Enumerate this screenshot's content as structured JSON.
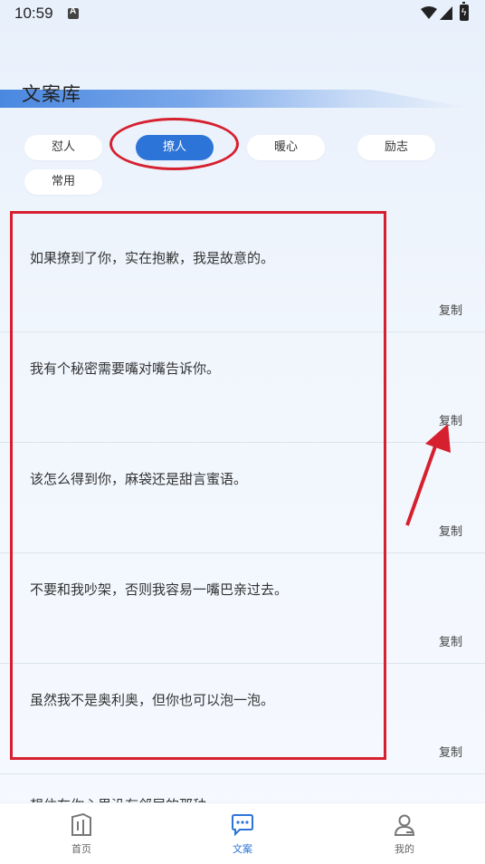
{
  "status_bar": {
    "time": "10:59"
  },
  "page_title": "文案库",
  "tags": [
    {
      "label": "怼人",
      "active": false
    },
    {
      "label": "撩人",
      "active": true
    },
    {
      "label": "暖心",
      "active": false
    },
    {
      "label": "励志",
      "active": false
    },
    {
      "label": "常用",
      "active": false
    }
  ],
  "items": [
    {
      "text": "如果撩到了你，实在抱歉，我是故意的。",
      "copy_label": "复制"
    },
    {
      "text": "我有个秘密需要嘴对嘴告诉你。",
      "copy_label": "复制"
    },
    {
      "text": "该怎么得到你，麻袋还是甜言蜜语。",
      "copy_label": "复制"
    },
    {
      "text": "不要和我吵架，否则我容易一嘴巴亲过去。",
      "copy_label": "复制"
    },
    {
      "text": "虽然我不是奥利奥，但你也可以泡一泡。",
      "copy_label": "复制"
    }
  ],
  "peek_text": "想住在你心里没有邻居的那种",
  "bottom_nav": {
    "home_label": "首页",
    "copywriting_label": "文案",
    "mine_label": "我的"
  },
  "colors": {
    "accent": "#2d74d8",
    "annotation": "#d6202f"
  }
}
